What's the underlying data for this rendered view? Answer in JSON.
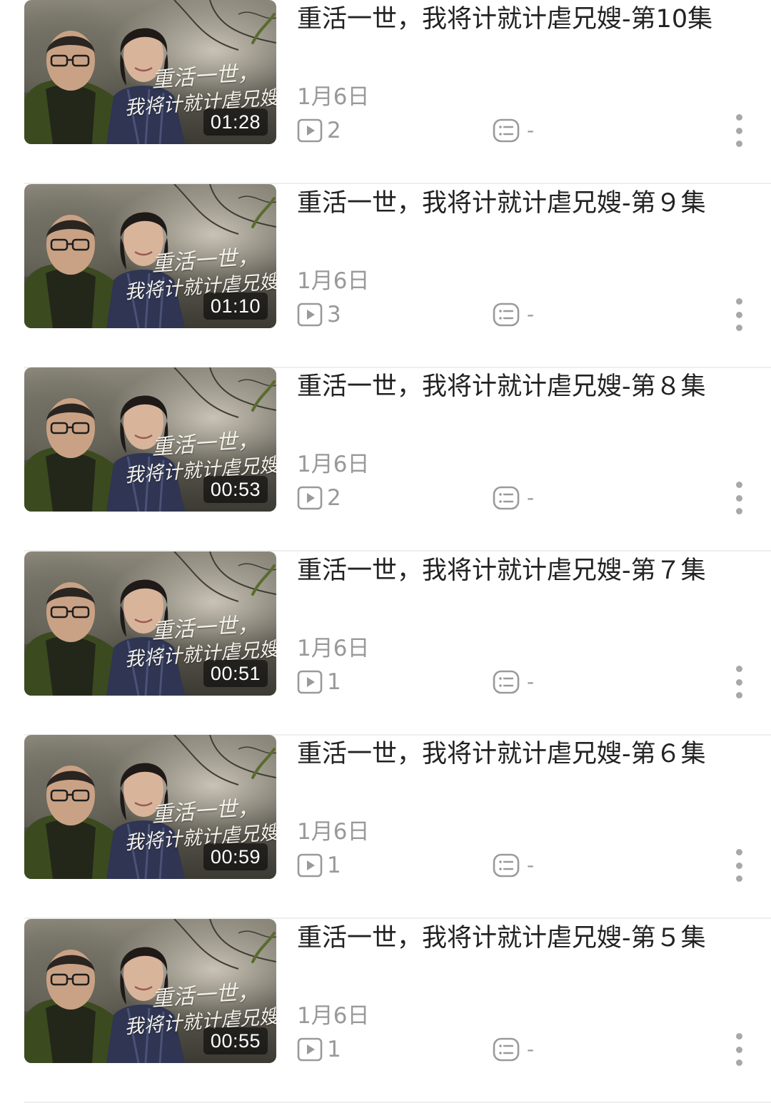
{
  "videos": [
    {
      "title": "重活一世，我将计就计虐兄嫂-第10集",
      "thumbnail_text_line1": "重活一世，",
      "thumbnail_text_line2": "我将计就计虐兄嫂",
      "duration": "01:28",
      "date": "1月6日",
      "plays": "2",
      "comments": "-"
    },
    {
      "title": "重活一世，我将计就计虐兄嫂-第９集",
      "thumbnail_text_line1": "重活一世，",
      "thumbnail_text_line2": "我将计就计虐兄嫂",
      "duration": "01:10",
      "date": "1月6日",
      "plays": "3",
      "comments": "-"
    },
    {
      "title": "重活一世，我将计就计虐兄嫂-第８集",
      "thumbnail_text_line1": "重活一世，",
      "thumbnail_text_line2": "我将计就计虐兄嫂",
      "duration": "00:53",
      "date": "1月6日",
      "plays": "2",
      "comments": "-"
    },
    {
      "title": "重活一世，我将计就计虐兄嫂-第７集",
      "thumbnail_text_line1": "重活一世，",
      "thumbnail_text_line2": "我将计就计虐兄嫂",
      "duration": "00:51",
      "date": "1月6日",
      "plays": "1",
      "comments": "-"
    },
    {
      "title": "重活一世，我将计就计虐兄嫂-第６集",
      "thumbnail_text_line1": "重活一世，",
      "thumbnail_text_line2": "我将计就计虐兄嫂",
      "duration": "00:59",
      "date": "1月6日",
      "plays": "1",
      "comments": "-"
    },
    {
      "title": "重活一世，我将计就计虐兄嫂-第５集",
      "thumbnail_text_line1": "重活一世，",
      "thumbnail_text_line2": "我将计就计虐兄嫂",
      "duration": "00:55",
      "date": "1月6日",
      "plays": "1",
      "comments": "-"
    }
  ]
}
